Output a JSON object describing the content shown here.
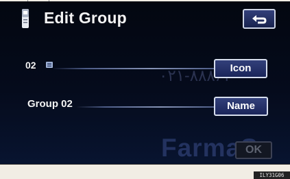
{
  "header": {
    "title": "Edit Group",
    "phone_icon": "phone-icon",
    "back_icon": "return-arrow-icon"
  },
  "rows": [
    {
      "label": "02",
      "label_icon": "group-icon",
      "button": "Icon"
    },
    {
      "label": "Group 02",
      "button": "Name"
    }
  ],
  "footer": {
    "ok_label": "OK",
    "ok_enabled": false
  },
  "watermark": {
    "digits": "۰۲۱-۸۸۸۶۲",
    "brand": "FarmaS"
  },
  "figure_id": "ILY31G06",
  "colors": {
    "screen_bg": "#050b1c",
    "button_bg": "#22306a",
    "button_border": "#d7deee",
    "disabled_text": "#5d6270"
  }
}
